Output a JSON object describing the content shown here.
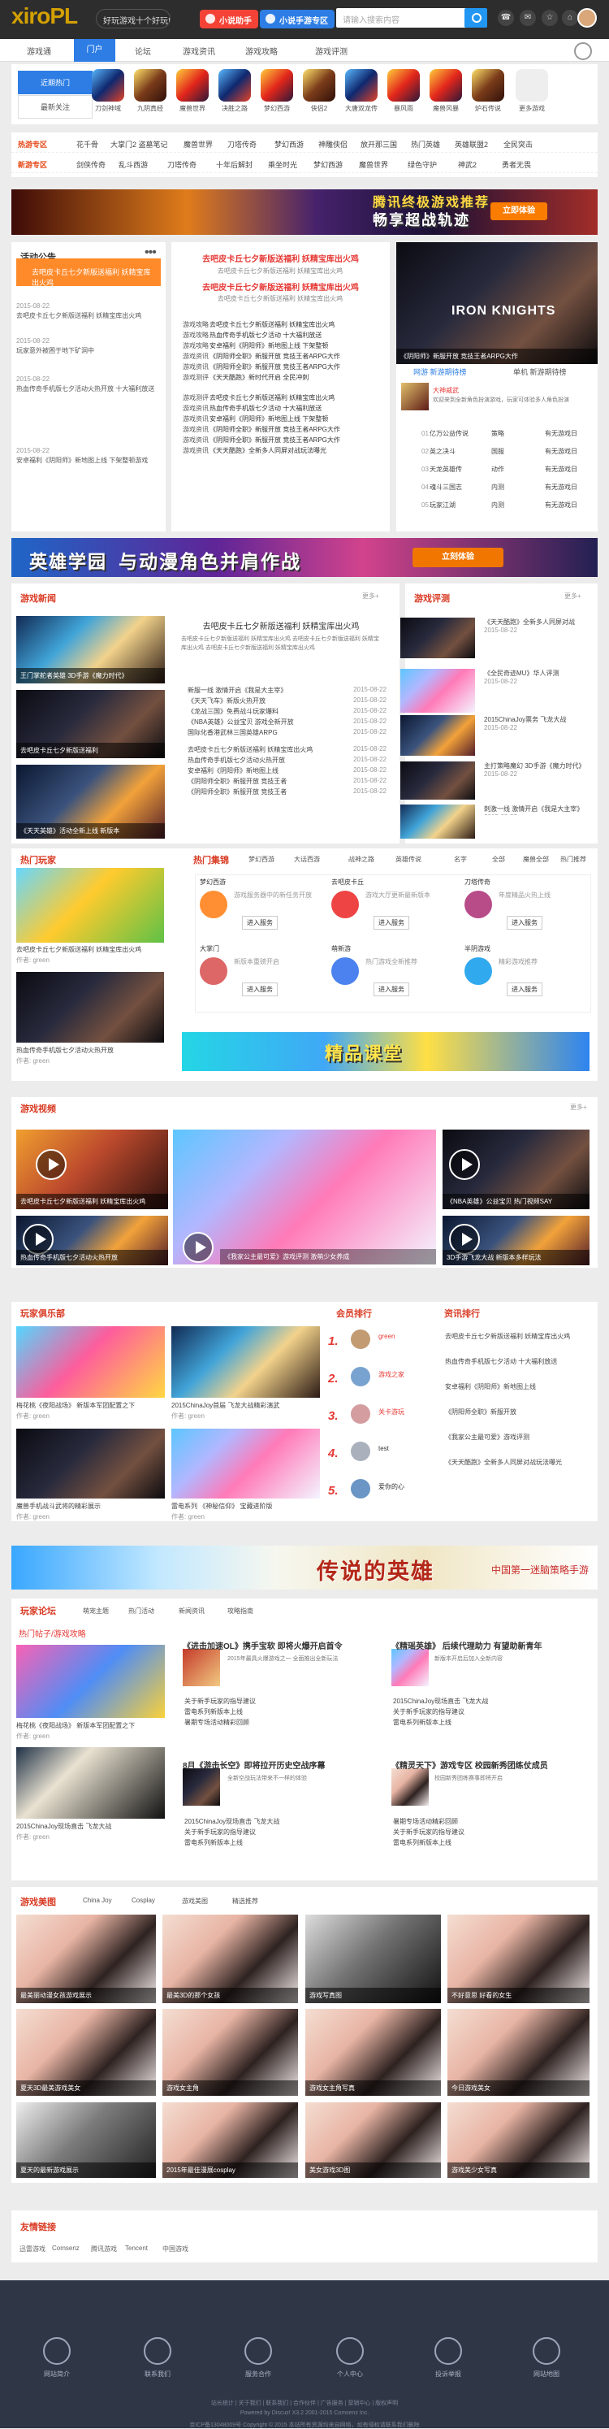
{
  "site": {
    "logo": "xiro",
    "logo2": "PL",
    "top_note": "好玩游戏十个好玩!",
    "mobile_game": "小说助手",
    "tencent_game": "小说手游专区",
    "search_placeholder": "请输入搜索内容",
    "top_icons": [
      "☎",
      "✉",
      "☆",
      "⌂"
    ]
  },
  "nav": {
    "items": [
      "游戏通",
      "门户",
      "论坛",
      "游戏资讯",
      "游戏攻略",
      "游戏评测"
    ]
  },
  "hot": {
    "tabs": [
      "近期热门",
      "最新关注"
    ],
    "games": [
      "刀剑神域",
      "九阴真经",
      "魔兽世界",
      "决胜之路",
      "梦幻西游",
      "侠侣2",
      "大唐双龙传",
      "暴风雨",
      "魔兽风暴",
      "炉石传说",
      "更多游戏"
    ]
  },
  "tags": {
    "rows": [
      {
        "head": "热游专区",
        "items": [
          "花千骨",
          "大掌门2 盗墓笔记",
          "魔兽世界",
          "刀塔传奇",
          "梦幻西游",
          "神雕侠侣",
          "放开那三国",
          "热门英雄",
          "英雄联盟2",
          "全民突击",
          "我是大主宰",
          "魔兽来历"
        ]
      },
      {
        "head": "新游专区",
        "items": [
          "剑侠传奇",
          "乱斗西游",
          "刀塔传奇",
          "十年后解封",
          "乘坐时光",
          "梦幻西游",
          "魔兽世界",
          "绿色守护",
          "神武2",
          "勇者无畏",
          "热血传奇",
          "大唐双龙传"
        ]
      }
    ]
  },
  "banners": {
    "first": {
      "text1": "腾讯终极游戏推荐",
      "text2": "畅享超战轨迹",
      "btn": "立即体验"
    },
    "second": {
      "text1": "英雄学园",
      "text2": "与动漫角色并肩作战",
      "btn": "立刻体验"
    }
  },
  "activity": {
    "title": "活动公告",
    "notice": "去吧皮卡丘七夕新版送福利 妖精宝库出火鸡",
    "items": [
      {
        "date": "2015-08-22",
        "title": "去吧皮卡丘七夕新版送福利 妖精宝库出火鸡"
      },
      {
        "date": "2015-08-22",
        "title": "玩家意外被困于地下矿洞中"
      },
      {
        "date": "2015-08-22",
        "title": "热血传奇手机版七夕活动火热开放 十大福利放送"
      },
      {
        "date": "2015-08-22",
        "title": "安卓福利《阴阳师》新地图上线 下架整顿游戏"
      }
    ]
  },
  "news": {
    "headline": "去吧皮卡丘七夕新版送福利 妖精宝库出火鸡",
    "sub": "去吧皮卡丘七夕新版送福利 妖精宝库出火鸡",
    "rows": [
      [
        "游戏攻略",
        "去吧皮卡丘七夕新版送福利 妖精宝库出火鸡"
      ],
      [
        "游戏攻略",
        "热血传奇手机版七夕活动 十大福利放送"
      ],
      [
        "游戏攻略",
        "安卓福利《阴阳师》新地图上线 下架整顿"
      ],
      [
        "游戏资讯",
        "《阴阳师全职》新服开放 竞技王者ARPG大作"
      ],
      [
        "游戏资讯",
        "《阴阳师全职》新服开放 竞技王者ARPG大作"
      ],
      [
        "游戏测评",
        "《天天酷跑》新时代开启 全民冲刺"
      ],
      [
        "游戏测评",
        "去吧皮卡丘七夕新版送福利 妖精宝库出火鸡"
      ],
      [
        "游戏资讯",
        "热血传奇手机版七夕活动 十大福利放送"
      ],
      [
        "游戏资讯",
        "安卓福利《阴阳师》新地图上线 下架整顿"
      ],
      [
        "游戏资讯",
        "《阴阳师全职》新服开放 竞技王者ARPG大作"
      ],
      [
        "游戏资讯",
        "《阴阳师全职》新服开放 竞技王者ARPG大作"
      ],
      [
        "游戏资讯",
        "《天天酷跑》全新多人同屏对战玩法曝光"
      ]
    ]
  },
  "rank": {
    "hero": "IRON KNIGHTS",
    "title": "《阴阳师》新服开放 竞技王者ARPG大作",
    "tabs": [
      "网游 新游期待榜",
      "单机 新游期待榜"
    ],
    "featured": "大神威武",
    "featured_desc": "欢迎来到全新角色扮演游戏，玩家可体验多人角色扮演",
    "items": [
      [
        "01",
        "亿万公益传说",
        "策略",
        "有无游戏日"
      ],
      [
        "02",
        "英之决斗",
        "国服",
        "有无游戏日"
      ],
      [
        "03",
        "天龙英雄传",
        "动作",
        "有无游戏日"
      ],
      [
        "04",
        "魂斗三国志",
        "内测",
        "有无游戏日"
      ],
      [
        "05",
        "玩家江湖",
        "内测",
        "有无游戏日"
      ]
    ]
  },
  "game_news": {
    "title": "游戏新闻",
    "more": "更多+",
    "center_title": "去吧皮卡丘七夕新版送福利 妖精宝库出火鸡",
    "center_desc": "去吧皮卡丘七夕新版送福利 妖精宝库出火鸡 去吧皮卡丘七夕新版送福利 妖精宝库出火鸡 去吧皮卡丘七夕新版送福利 妖精宝库出火鸡",
    "side": [
      "王门掌舵者英雄 3D手游《魔力时代》",
      "去吧皮卡丘七夕新版送福利",
      "《天天英雄》活动全新上线 新版本"
    ],
    "rows": [
      [
        "新服一线 激情开启《我是大主宰》",
        "2015-08-22"
      ],
      [
        "《天天飞车》新版火热开放",
        "2015-08-22"
      ],
      [
        "《龙战三国》免费战斗玩家爆料",
        "2015-08-22"
      ],
      [
        "《NBA英雄》公益宝贝 游戏全新开放",
        "2015-08-22"
      ],
      [
        "国际化香港武林三国英雄ARPG",
        "2015-08-22"
      ],
      [
        "去吧皮卡丘七夕新版送福利 妖精宝库出火鸡",
        "2015-08-22"
      ],
      [
        "热血传奇手机版七夕活动火热开放",
        "2015-08-22"
      ],
      [
        "安卓福利《阴阳师》新地图上线",
        "2015-08-22"
      ],
      [
        "《阴阳师全职》新服开放 竞技王者",
        "2015-08-22"
      ],
      [
        "《阴阳师全职》新服开放 竞技王者",
        "2015-08-22"
      ]
    ]
  },
  "reviews": {
    "title": "游戏评测",
    "more": "更多+",
    "items": [
      [
        "《天天酷跑》全新多人同屏对战",
        "2015-08-22"
      ],
      [
        "《全民奇迹MU》华人评测",
        "2015-08-22"
      ],
      [
        "2015ChinaJoy票务 飞龙大战",
        "2015-08-22"
      ],
      [
        "主打策略魔幻 3D手游《魔力时代》",
        "2015-08-22"
      ],
      [
        "刺激一线 激情开启《我是大主宰》",
        "2015-08-22"
      ]
    ]
  },
  "players": {
    "title": "热门玩家",
    "profile": "热门专栏",
    "items": [
      "去吧皮卡丘七夕新版送福利 妖精宝库出火鸡",
      "热血传奇手机版七夕活动火热开放"
    ],
    "author": "作者: green",
    "views": "2"
  },
  "hot_collections": {
    "title": "热门集锦",
    "tabs": [
      "梦幻西游",
      "大话西游",
      "战神之路",
      "英雄传说",
      "名字",
      "全部",
      "魔兽全部",
      "热门推荐"
    ],
    "cards": [
      [
        "梦幻西游",
        "游戏服务器中的新任务开放",
        "进入服务"
      ],
      [
        "去吧皮卡丘",
        "游戏大厅更新最新版本",
        "进入服务"
      ],
      [
        "刀塔传奇",
        "年度精品火热上线",
        "进入服务"
      ],
      [
        "大掌门",
        "新版本重磅开启",
        "进入服务"
      ],
      [
        "萌新游",
        "热门游戏全新推荐",
        "进入服务"
      ],
      [
        "半阴游戏",
        "精彩游戏推荐",
        "进入服务"
      ]
    ],
    "banner": "精品课堂"
  },
  "videos": {
    "title": "游戏视频",
    "more": "更多+",
    "items": [
      "去吧皮卡丘七夕新版送福利 妖精宝库出火鸡",
      "《NBA英雄》公益宝贝 热门视频SAY",
      "热血传奇手机版七夕活动火热开放",
      "《我家公主最可爱》游戏评测 激萌少女养成",
      "3D手游飞龙大战 新版本多样玩法"
    ]
  },
  "club": {
    "title": "玩家俱乐部",
    "items": [
      "梅花桃《夜阳战场》 新版本军团配置之下",
      "2015ChinaJoy首届 飞龙大战精彩演武",
      "魔兽手机战斗武将的精彩展示",
      "雷电系列 《神秘信仰》 宝藏进阶版"
    ],
    "author": "作者: green"
  },
  "ranking": {
    "title": "会员排行",
    "users": [
      "green",
      "游戏之家",
      "关卡游玩",
      "test",
      "爱你的心"
    ]
  },
  "strategy": {
    "title": "资讯排行",
    "items": [
      "去吧皮卡丘七夕新版送福利 妖精宝库出火鸡",
      "热血传奇手机版七夕活动 十大福利放送",
      "安卓福利《阴阳师》新地图上线",
      "《阴阳师全职》新服开放",
      "《我家公主最可爱》游戏评测",
      "《天天酷跑》全新多人同屏对战玩法曝光"
    ]
  },
  "mid_banner": {
    "text": "传说的英雄",
    "sub": "中国第一迷脑策略手游"
  },
  "forum": {
    "title": "玩家论坛",
    "tabs": [
      "萌宠主题",
      "热门活动",
      "新闻资讯",
      "攻略指南"
    ],
    "subtitle": "热门帖子/游戏攻略",
    "posts": [
      [
        "《进击加速OL》携手宝软 即将火爆开启首令",
        "2015年最具火爆游戏之一 全面推出全新玩法"
      ],
      [
        "《精瑶英雄》 后续代理助力 有望助新青年",
        "新版本开启后加入全新内容"
      ],
      [
        "8月《游击长空》即将拉开历史空战序幕",
        "全新空战玩法带来不一样的体验"
      ],
      [
        "《精灵天下》游戏专区 校园新秀团练仗成员",
        "校园新秀团练赛事即将开启"
      ]
    ],
    "rows": [
      "2015ChinaJoy现场直击 飞龙大战",
      "关于新手玩家的指导建议",
      "雷电系列新版本上线",
      "暑期专场活动精彩回顾"
    ],
    "authors": [
      "作者: green",
      "作者: green"
    ]
  },
  "beauty": {
    "title": "游戏美图",
    "tabs": [
      "China Joy",
      "Cosplay",
      "游戏美图",
      "精选推荐"
    ],
    "items": [
      "最美丽动漫女孩游戏展示",
      "最美3D的那个女孩",
      "游戏写真图",
      "不好意思 好看的女生",
      "夏天3D最美游戏美女",
      "游戏女主角",
      "游戏女主角写真",
      "今日游戏美女",
      "夏天的最新游戏展示",
      "2015年最佳漫展cosplay",
      "美女游戏3D图",
      "游戏美少女写真"
    ]
  },
  "friend_links": {
    "title": "友情链接",
    "items": [
      "迅雷游戏",
      "Comsenz",
      "腾讯游戏",
      "Tencent",
      "中国游戏"
    ]
  },
  "footer": {
    "items": [
      "网站简介",
      "联系我们",
      "服务合作",
      "个人中心",
      "投诉举报",
      "网站地图"
    ],
    "links": "站长统计 | 关于我们 | 联系我们 | 合作伙伴 | 广告服务 | 营销中心 | 版权声明",
    "powered": "Powered by Discuz! X3.2 2001-2015 Comsenz Inc.",
    "copyright": "京ICP备13048009号 Copyright © 2015 本站所有资源均来自网络，如有侵权请联系我们删除"
  }
}
